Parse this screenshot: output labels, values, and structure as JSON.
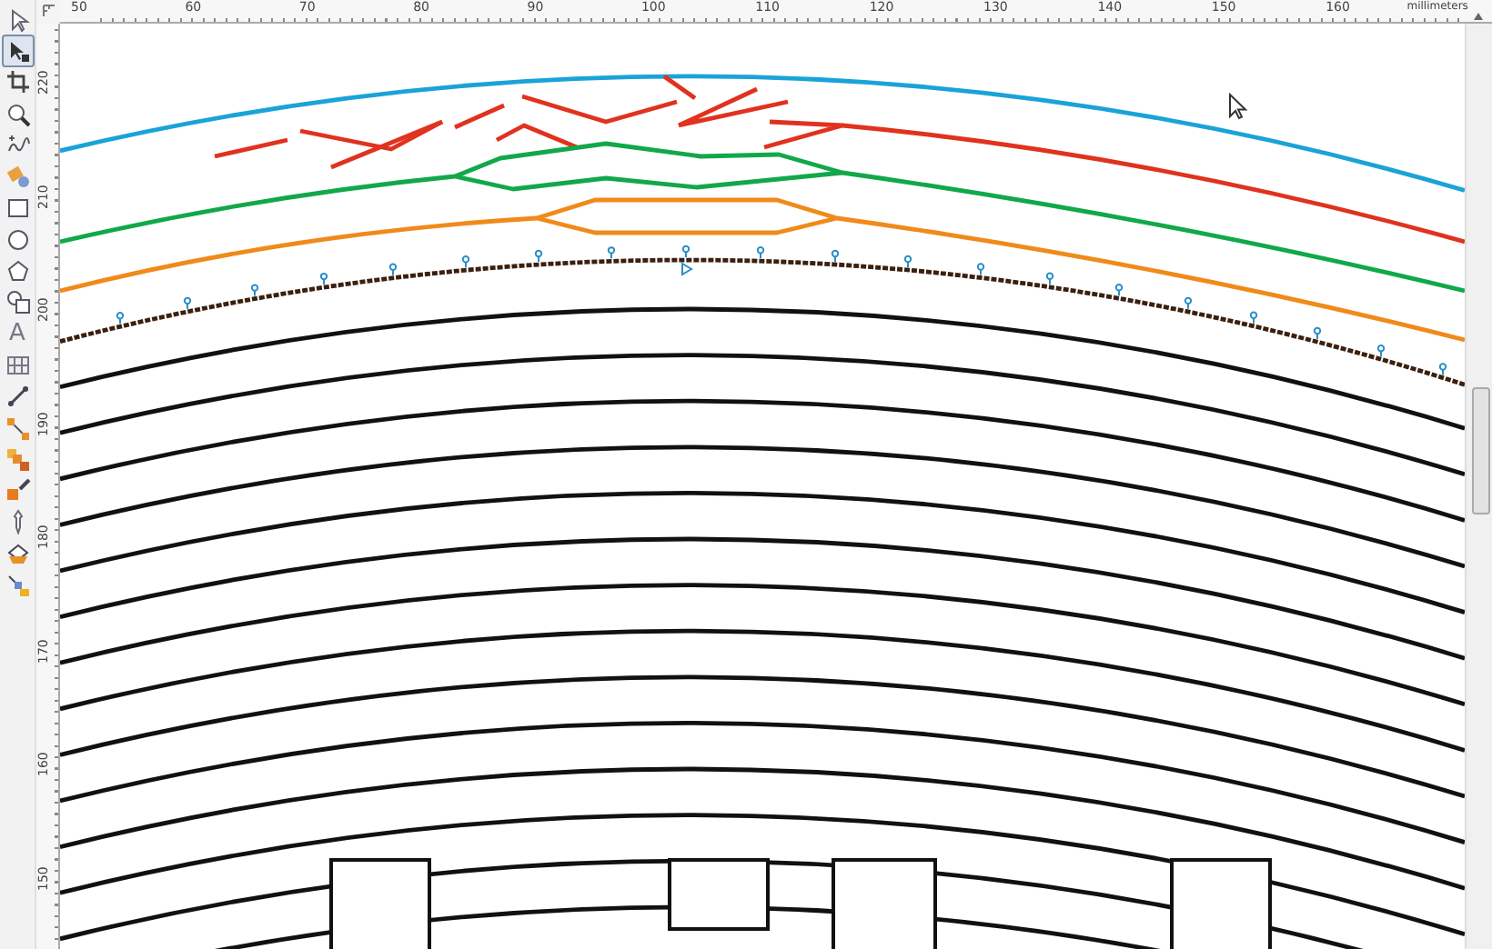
{
  "toolbox": {
    "tools": [
      {
        "kind": "pick",
        "selected": false
      },
      {
        "kind": "shape",
        "selected": true
      },
      {
        "kind": "crop",
        "selected": false
      },
      {
        "kind": "zoom",
        "selected": false
      },
      {
        "kind": "freehand",
        "selected": false
      },
      {
        "kind": "smartfill",
        "selected": false
      },
      {
        "kind": "rectangle",
        "selected": false
      },
      {
        "kind": "ellipse",
        "selected": false
      },
      {
        "kind": "polygon",
        "selected": false
      },
      {
        "kind": "basicshapes",
        "selected": false
      },
      {
        "kind": "text",
        "glyph": "A",
        "selected": false
      },
      {
        "kind": "table",
        "selected": false
      },
      {
        "kind": "dimension",
        "selected": false
      },
      {
        "kind": "connector",
        "selected": false
      },
      {
        "kind": "blend",
        "selected": false
      },
      {
        "kind": "effects",
        "selected": false
      },
      {
        "kind": "eyedropper",
        "selected": false
      },
      {
        "kind": "fill",
        "selected": false
      },
      {
        "kind": "interactivefill",
        "selected": false
      }
    ]
  },
  "rulers": {
    "top": {
      "labels": [
        "50",
        "60",
        "70",
        "80",
        "90",
        "100",
        "110",
        "120",
        "130",
        "140",
        "150",
        "160"
      ],
      "unit": "millimeters"
    },
    "left": {
      "labels": [
        "220",
        "210",
        "200",
        "190",
        "180",
        "170",
        "160",
        "150"
      ]
    }
  }
}
